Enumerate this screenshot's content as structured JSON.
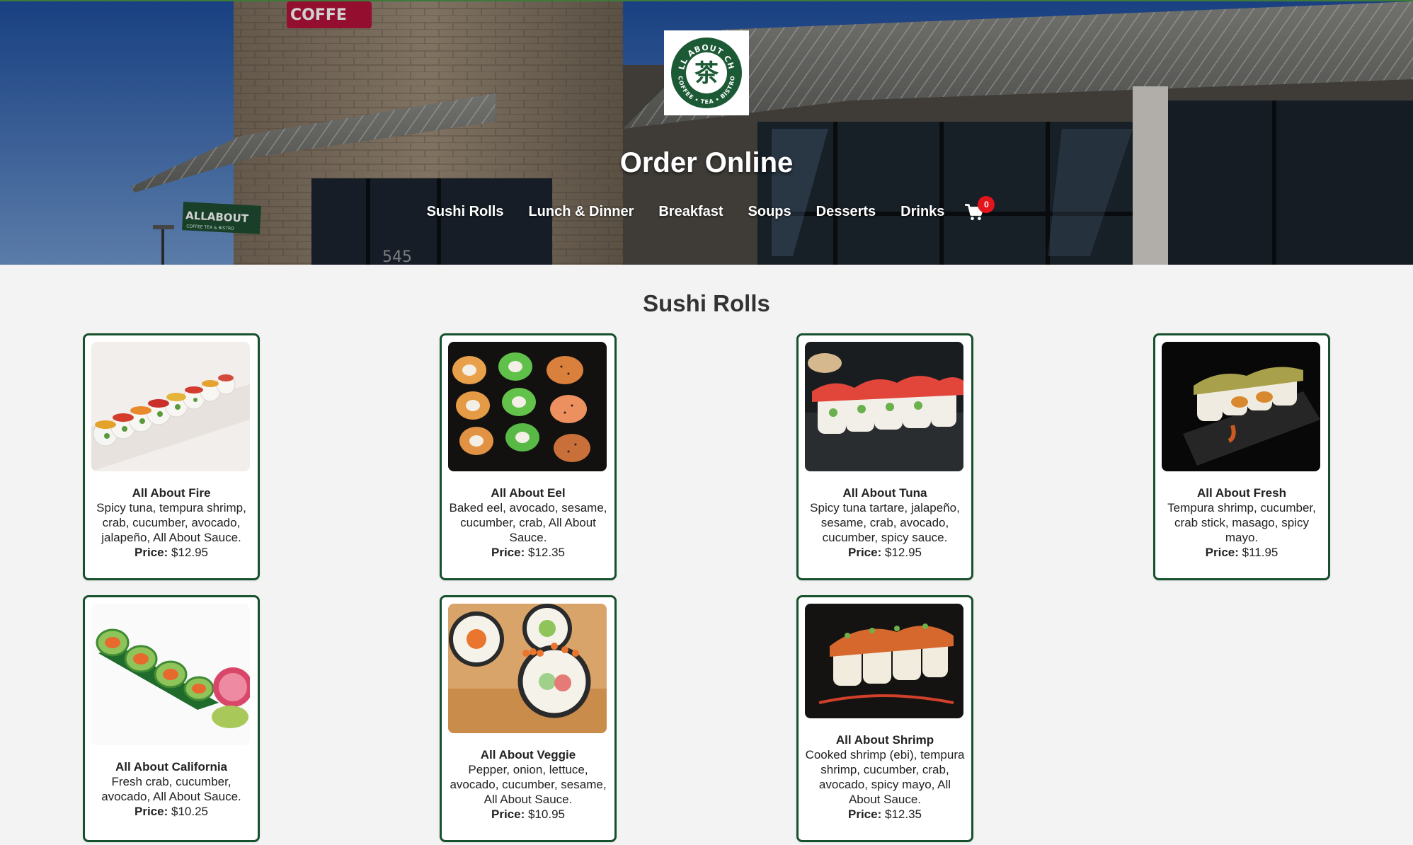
{
  "header": {
    "logo_text_top": "ALL ABOUT CHA",
    "logo_text_bottom": "COFFEE • TEA • BISTRO",
    "logo_glyph": "茶",
    "title": "Order Online",
    "nav": [
      "Sushi Rolls",
      "Lunch & Dinner",
      "Breakfast",
      "Soups",
      "Desserts",
      "Drinks"
    ],
    "cart_count": "0",
    "cart_icon": "shopping-cart-icon",
    "storefront_sign": "ALLABOUT",
    "storefront_sign_sub": "COFFEE TEA & BISTRO",
    "top_sign": "COFFE",
    "address_number": "545"
  },
  "section": {
    "title": "Sushi Rolls"
  },
  "price_label": "Price:",
  "colors": {
    "card_border": "#17502c",
    "logo_green": "#1c5a35",
    "cart_badge": "#e3141b",
    "page_bg": "#f3f3f3"
  },
  "items": [
    {
      "name": "All About Fire",
      "desc": "Spicy tuna, tempura shrimp, crab, cucumber, avocado, jalapeño, All About Sauce.",
      "price": "$12.95"
    },
    {
      "name": "All About Eel",
      "desc": "Baked eel, avocado, sesame, cucumber, crab, All About Sauce.",
      "price": "$12.35"
    },
    {
      "name": "All About Tuna",
      "desc": "Spicy tuna tartare, jalapeño, sesame, crab, avocado, cucumber, spicy sauce.",
      "price": "$12.95"
    },
    {
      "name": "All About Fresh",
      "desc": "Tempura shrimp, cucumber, crab stick, masago, spicy mayo.",
      "price": "$11.95"
    },
    {
      "name": "All About California",
      "desc": "Fresh crab, cucumber, avocado, All About Sauce.",
      "price": "$10.25"
    },
    {
      "name": "All About Veggie",
      "desc": "Pepper, onion, lettuce, avocado, cucumber, sesame, All About Sauce.",
      "price": "$10.95"
    },
    {
      "name": "All About Shrimp",
      "desc": "Cooked shrimp (ebi), tempura shrimp, cucumber, crab, avocado, spicy mayo, All About Sauce.",
      "price": "$12.35"
    }
  ]
}
